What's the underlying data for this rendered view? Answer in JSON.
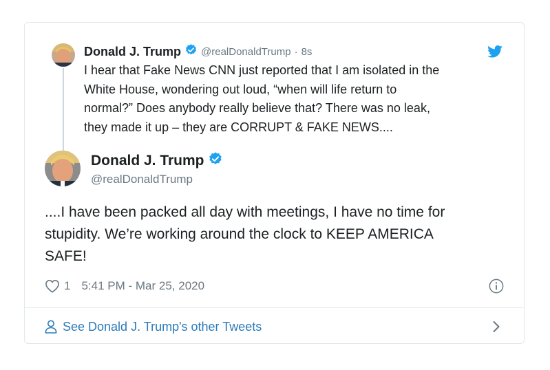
{
  "reply_tweet": {
    "author_name": "Donald J. Trump",
    "handle": "@realDonaldTrump",
    "separator": "·",
    "time_ago": "8s",
    "text": "I hear that Fake News CNN just reported that I am isolated in the\nWhite House, wondering out loud, “when will life return to\nnormal?” Does anybody really believe that? There was no leak,\nthey made it up – they are CORRUPT & FAKE NEWS...."
  },
  "main_tweet": {
    "author_name": "Donald J. Trump",
    "handle": "@realDonaldTrump",
    "text": "....I have been packed all day with meetings, I have no time for\nstupidity. We’re working around the clock to KEEP AMERICA\nSAFE!",
    "like_count": "1",
    "timestamp": "5:41 PM - Mar 25, 2020"
  },
  "footer": {
    "see_more_label": "See Donald J. Trump's other Tweets"
  },
  "icons": {
    "verified": "verified-badge-icon",
    "twitter": "twitter-bird-icon",
    "like": "heart-icon",
    "info": "info-icon",
    "user": "user-icon",
    "chevron": "chevron-right-icon"
  },
  "colors": {
    "brand_blue": "#1da1f2",
    "link_blue": "#2b7bb9",
    "text": "#1c2022",
    "muted": "#697882",
    "border": "#e1e8ed"
  }
}
